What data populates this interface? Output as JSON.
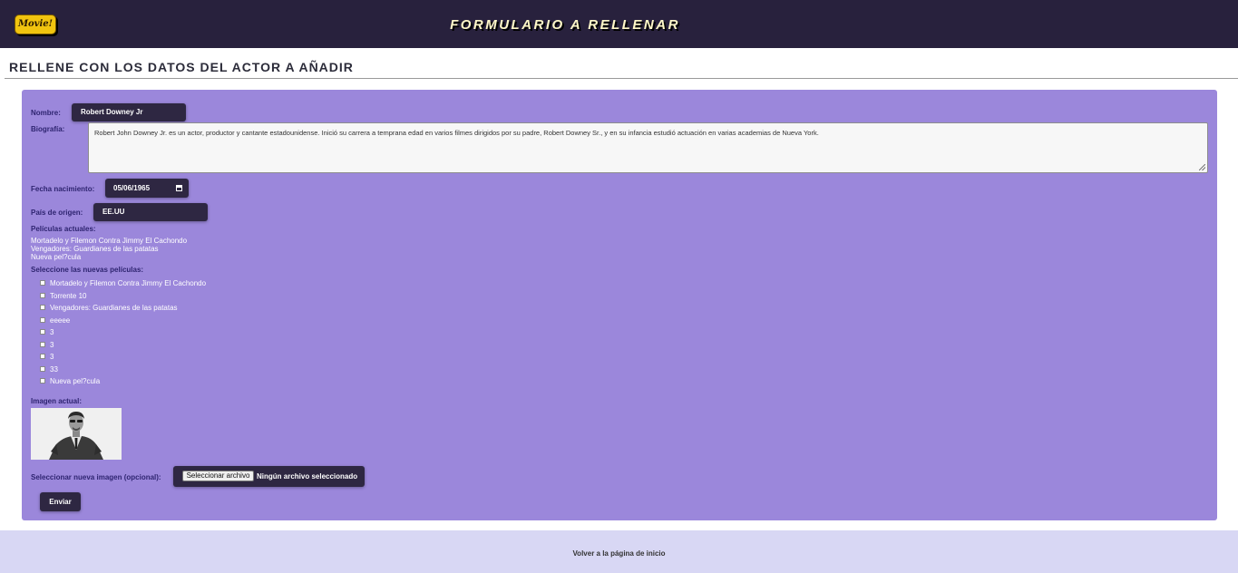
{
  "header": {
    "logo_text": "Movie!",
    "title": "FORMULARIO A RELLENAR"
  },
  "page_title": "RELLENE CON LOS DATOS DEL ACTOR A AÑADIR",
  "form": {
    "nombre_label": "Nombre:",
    "nombre_value": "Robert Downey Jr",
    "biografia_label": "Biografía:",
    "biografia_value": "Robert John Downey Jr. es un actor, productor y cantante estadounidense. Inició su carrera a temprana edad en varios filmes dirigidos por su padre, Robert Downey Sr., y en su infancia estudió actuación en varias academias de Nueva York.",
    "fecha_label": "Fecha nacimiento:",
    "fecha_value": "05/06/1965",
    "pais_label": "País de origen:",
    "pais_value": "EE.UU",
    "peliculas_actuales_label": "Películas actuales:",
    "peliculas_actuales": [
      "Mortadelo y Filemon Contra Jimmy El Cachondo",
      "Vengadores: Guardianes de las patatas",
      "Nueva pel?cula"
    ],
    "nuevas_peliculas_label": "Seleccione las nuevas películas:",
    "nuevas_peliculas": [
      "Mortadelo y Filemon Contra Jimmy El Cachondo",
      "Torrente 10",
      "Vengadores: Guardianes de las patatas",
      "eeeee",
      "3",
      "3",
      "3",
      "33",
      "Nueva pel?cula"
    ],
    "imagen_actual_label": "Imagen actual:",
    "nueva_imagen_label": "Seleccionar nueva imagen (opcional):",
    "file_button_label": "Seleccionar archivo",
    "file_status": "Ningún archivo seleccionado",
    "submit_label": "Enviar"
  },
  "footer": {
    "link_text": "Volver a la página de inicio"
  },
  "colors": {
    "header_bg": "#28213d",
    "panel_bg": "#9b87db",
    "footer_bg": "#d8d7f4",
    "dark_input_bg": "#2e2742"
  }
}
